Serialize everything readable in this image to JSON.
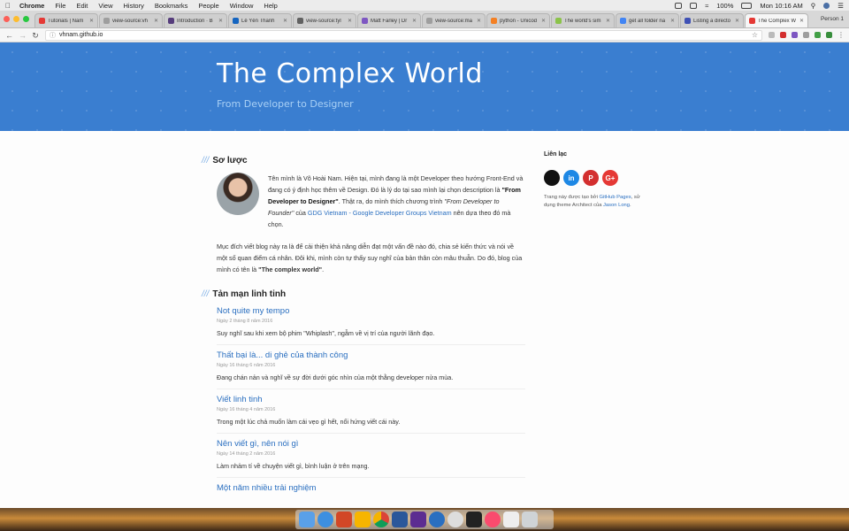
{
  "menubar": {
    "app": "Chrome",
    "items": [
      "File",
      "Edit",
      "View",
      "History",
      "Bookmarks",
      "People",
      "Window",
      "Help"
    ],
    "battery": "100%",
    "clock": "Mon 10:16 AM"
  },
  "tabs": [
    {
      "label": "Tutorials | Nam",
      "color": "#e53935"
    },
    {
      "label": "view-source:vh",
      "color": "#9e9e9e"
    },
    {
      "label": "Introduction · B",
      "color": "#563d7c"
    },
    {
      "label": "Lê Yên Thanh",
      "color": "#1565c0"
    },
    {
      "label": "view-source:tyl",
      "color": "#616161"
    },
    {
      "label": "Matt Farley | Dr",
      "color": "#7e57c2"
    },
    {
      "label": "view-source:ma",
      "color": "#9e9e9e"
    },
    {
      "label": "python - Unicod",
      "color": "#f48024"
    },
    {
      "label": "The world's sim",
      "color": "#8bc34a"
    },
    {
      "label": "get all folder na",
      "color": "#4285f4"
    },
    {
      "label": "Listing a directo",
      "color": "#3f51b5"
    },
    {
      "label": "The Complex W",
      "color": "#e53935",
      "active": true
    }
  ],
  "person": "Person 1",
  "address": "vhnam.github.io",
  "site": {
    "title": "The Complex World",
    "subtitle": "From Developer to Designer"
  },
  "about": {
    "heading": "Sơ lược",
    "p1_a": "Tên mình là Võ Hoài Nam. Hiện tại, mình đang là một Developer theo hướng Front-End và đang có ý định học thêm về Design. Đó là lý do tại sao mình lại chọn description là ",
    "p1_b": "\"From Developer to Designer\"",
    "p1_c": ". Thật ra, do mình thích chương trình ",
    "p1_d": "\"From Developer to Founder\"",
    "p1_e": " của ",
    "p1_link": "GDG Vietnam - Google Developer Groups Vietnam",
    "p1_f": " nên dựa theo đó mà chọn.",
    "p2_a": "Mục đích viết blog này ra là để cải thiện khả năng diễn đạt một vấn đề nào đó, chia sẻ kiến thức và nói về một số quan điểm cá nhân. Đôi khi, mình còn tự thấy suy nghĩ của bản thân còn mâu thuẫn. Do đó, blog của mình có tên là ",
    "p2_b": "\"The complex world\"",
    "p2_c": "."
  },
  "posts_heading": "Tản mạn linh tinh",
  "posts": [
    {
      "title": "Not quite my tempo",
      "date": "Ngày 2 tháng 8 năm 2016",
      "summary": "Suy nghĩ sau khi xem bộ phim \"Whiplash\", ngẫm về vị trí của người lãnh đạo."
    },
    {
      "title": "Thất bại là... di ghẻ của thành công",
      "date": "Ngày 16 tháng 6 năm 2016",
      "summary": "Đang chán nản và nghĩ về sự đời dưới góc nhìn của một thằng developer nửa mùa."
    },
    {
      "title": "Viết linh tinh",
      "date": "Ngày 16 tháng 4 năm 2016",
      "summary": "Trong một lúc chả muốn làm cái vẹo gì hết, nổi hứng viết cái này."
    },
    {
      "title": "Nên viết gì, nên nói gì",
      "date": "Ngày 14 tháng 2 năm 2016",
      "summary": "Làm nhảm tí về chuyện viết gì, bình luận ở trên mạng."
    },
    {
      "title": "Một năm nhiều trải nghiệm",
      "date": "",
      "summary": ""
    }
  ],
  "sidebar": {
    "heading": "Liên lạc",
    "social": [
      {
        "name": "github",
        "glyph": "",
        "color": "#111111"
      },
      {
        "name": "linkedin",
        "glyph": "in",
        "color": "#1e88e5"
      },
      {
        "name": "pinterest",
        "glyph": "P",
        "color": "#d32f2f"
      },
      {
        "name": "google-plus",
        "glyph": "G+",
        "color": "#e53935"
      }
    ],
    "credit_a": "Trang này được tạo bởi ",
    "credit_link1": "GitHub Pages",
    "credit_b": ", sử dụng theme Architect của ",
    "credit_link2": "Jason Long",
    "credit_c": "."
  }
}
